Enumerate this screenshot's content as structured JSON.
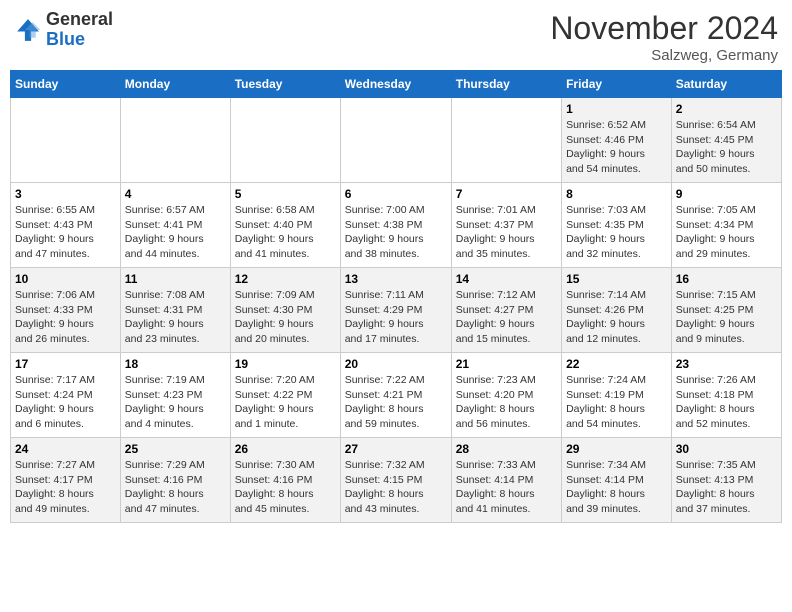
{
  "header": {
    "logo_general": "General",
    "logo_blue": "Blue",
    "month_title": "November 2024",
    "location": "Salzweg, Germany"
  },
  "days_of_week": [
    "Sunday",
    "Monday",
    "Tuesday",
    "Wednesday",
    "Thursday",
    "Friday",
    "Saturday"
  ],
  "weeks": [
    [
      {
        "day": "",
        "info": ""
      },
      {
        "day": "",
        "info": ""
      },
      {
        "day": "",
        "info": ""
      },
      {
        "day": "",
        "info": ""
      },
      {
        "day": "",
        "info": ""
      },
      {
        "day": "1",
        "info": "Sunrise: 6:52 AM\nSunset: 4:46 PM\nDaylight: 9 hours\nand 54 minutes."
      },
      {
        "day": "2",
        "info": "Sunrise: 6:54 AM\nSunset: 4:45 PM\nDaylight: 9 hours\nand 50 minutes."
      }
    ],
    [
      {
        "day": "3",
        "info": "Sunrise: 6:55 AM\nSunset: 4:43 PM\nDaylight: 9 hours\nand 47 minutes."
      },
      {
        "day": "4",
        "info": "Sunrise: 6:57 AM\nSunset: 4:41 PM\nDaylight: 9 hours\nand 44 minutes."
      },
      {
        "day": "5",
        "info": "Sunrise: 6:58 AM\nSunset: 4:40 PM\nDaylight: 9 hours\nand 41 minutes."
      },
      {
        "day": "6",
        "info": "Sunrise: 7:00 AM\nSunset: 4:38 PM\nDaylight: 9 hours\nand 38 minutes."
      },
      {
        "day": "7",
        "info": "Sunrise: 7:01 AM\nSunset: 4:37 PM\nDaylight: 9 hours\nand 35 minutes."
      },
      {
        "day": "8",
        "info": "Sunrise: 7:03 AM\nSunset: 4:35 PM\nDaylight: 9 hours\nand 32 minutes."
      },
      {
        "day": "9",
        "info": "Sunrise: 7:05 AM\nSunset: 4:34 PM\nDaylight: 9 hours\nand 29 minutes."
      }
    ],
    [
      {
        "day": "10",
        "info": "Sunrise: 7:06 AM\nSunset: 4:33 PM\nDaylight: 9 hours\nand 26 minutes."
      },
      {
        "day": "11",
        "info": "Sunrise: 7:08 AM\nSunset: 4:31 PM\nDaylight: 9 hours\nand 23 minutes."
      },
      {
        "day": "12",
        "info": "Sunrise: 7:09 AM\nSunset: 4:30 PM\nDaylight: 9 hours\nand 20 minutes."
      },
      {
        "day": "13",
        "info": "Sunrise: 7:11 AM\nSunset: 4:29 PM\nDaylight: 9 hours\nand 17 minutes."
      },
      {
        "day": "14",
        "info": "Sunrise: 7:12 AM\nSunset: 4:27 PM\nDaylight: 9 hours\nand 15 minutes."
      },
      {
        "day": "15",
        "info": "Sunrise: 7:14 AM\nSunset: 4:26 PM\nDaylight: 9 hours\nand 12 minutes."
      },
      {
        "day": "16",
        "info": "Sunrise: 7:15 AM\nSunset: 4:25 PM\nDaylight: 9 hours\nand 9 minutes."
      }
    ],
    [
      {
        "day": "17",
        "info": "Sunrise: 7:17 AM\nSunset: 4:24 PM\nDaylight: 9 hours\nand 6 minutes."
      },
      {
        "day": "18",
        "info": "Sunrise: 7:19 AM\nSunset: 4:23 PM\nDaylight: 9 hours\nand 4 minutes."
      },
      {
        "day": "19",
        "info": "Sunrise: 7:20 AM\nSunset: 4:22 PM\nDaylight: 9 hours\nand 1 minute."
      },
      {
        "day": "20",
        "info": "Sunrise: 7:22 AM\nSunset: 4:21 PM\nDaylight: 8 hours\nand 59 minutes."
      },
      {
        "day": "21",
        "info": "Sunrise: 7:23 AM\nSunset: 4:20 PM\nDaylight: 8 hours\nand 56 minutes."
      },
      {
        "day": "22",
        "info": "Sunrise: 7:24 AM\nSunset: 4:19 PM\nDaylight: 8 hours\nand 54 minutes."
      },
      {
        "day": "23",
        "info": "Sunrise: 7:26 AM\nSunset: 4:18 PM\nDaylight: 8 hours\nand 52 minutes."
      }
    ],
    [
      {
        "day": "24",
        "info": "Sunrise: 7:27 AM\nSunset: 4:17 PM\nDaylight: 8 hours\nand 49 minutes."
      },
      {
        "day": "25",
        "info": "Sunrise: 7:29 AM\nSunset: 4:16 PM\nDaylight: 8 hours\nand 47 minutes."
      },
      {
        "day": "26",
        "info": "Sunrise: 7:30 AM\nSunset: 4:16 PM\nDaylight: 8 hours\nand 45 minutes."
      },
      {
        "day": "27",
        "info": "Sunrise: 7:32 AM\nSunset: 4:15 PM\nDaylight: 8 hours\nand 43 minutes."
      },
      {
        "day": "28",
        "info": "Sunrise: 7:33 AM\nSunset: 4:14 PM\nDaylight: 8 hours\nand 41 minutes."
      },
      {
        "day": "29",
        "info": "Sunrise: 7:34 AM\nSunset: 4:14 PM\nDaylight: 8 hours\nand 39 minutes."
      },
      {
        "day": "30",
        "info": "Sunrise: 7:35 AM\nSunset: 4:13 PM\nDaylight: 8 hours\nand 37 minutes."
      }
    ]
  ]
}
